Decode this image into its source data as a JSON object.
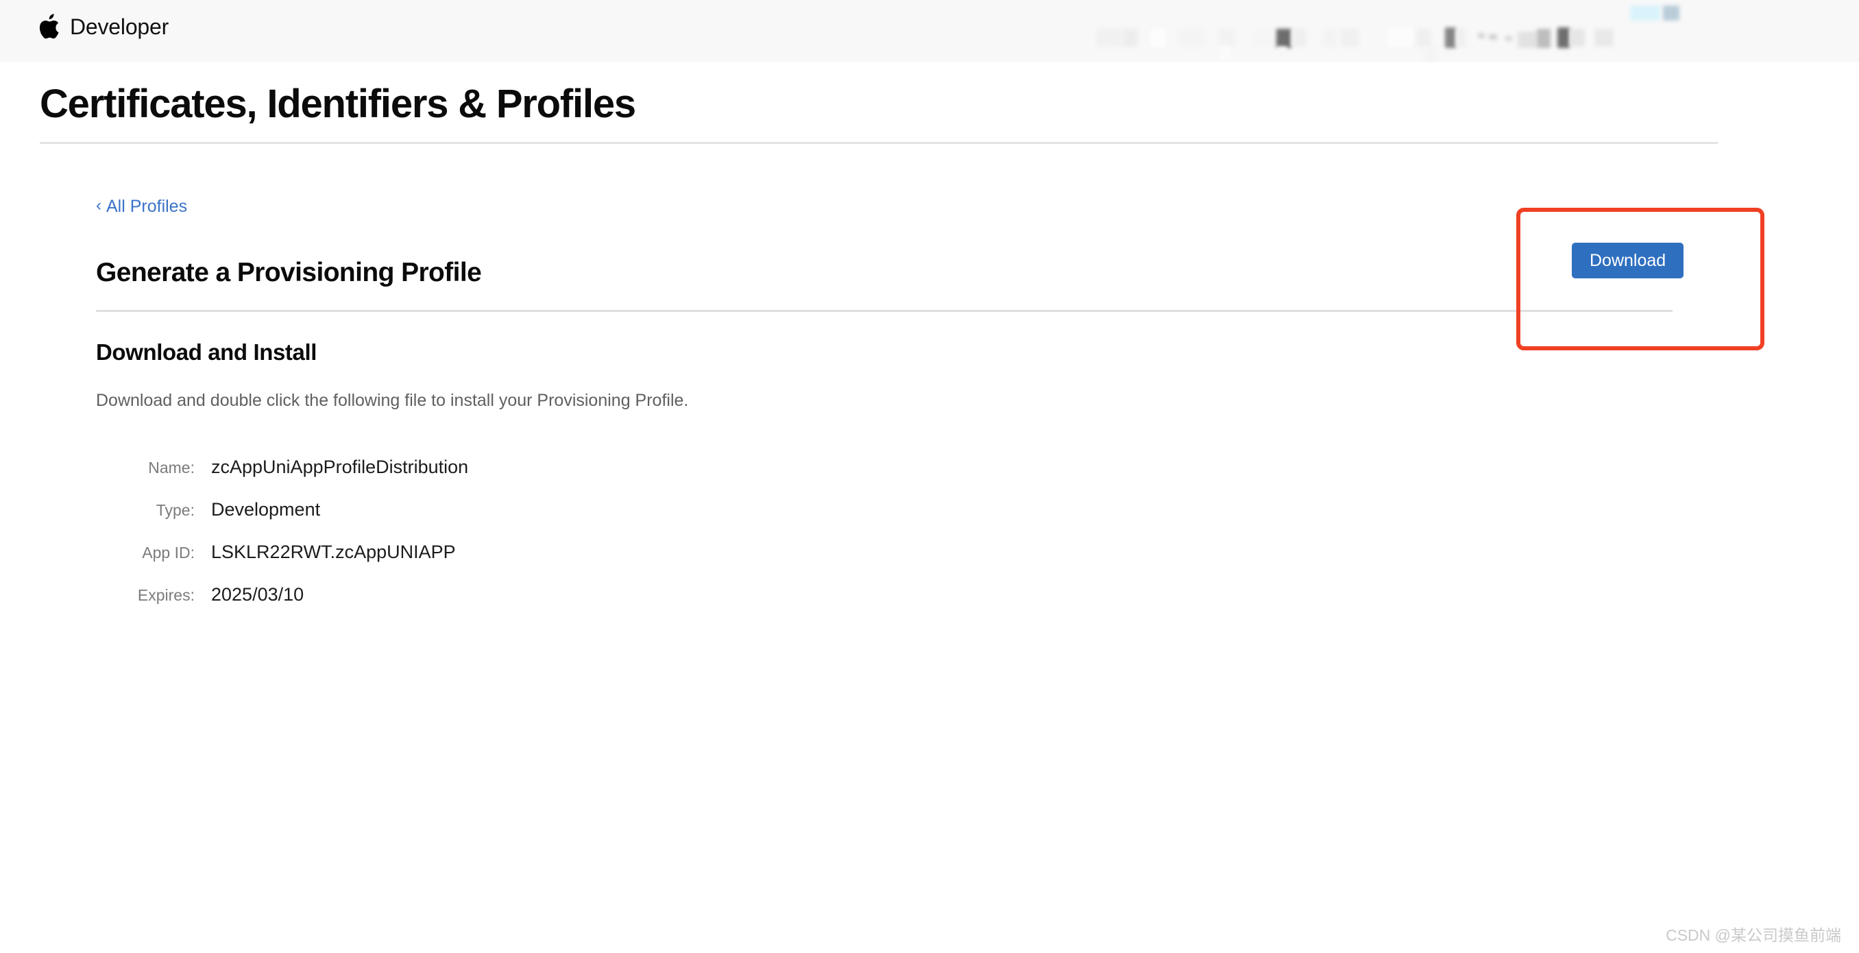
{
  "header": {
    "logo_icon": "apple-logo-icon",
    "brand_name": "Developer",
    "nav_redacted": true
  },
  "page": {
    "title": "Certificates, Identifiers & Profiles"
  },
  "breadcrumb": {
    "chevron": "‹",
    "label": "All Profiles"
  },
  "main": {
    "heading": "Generate a Provisioning Profile",
    "download_label": "Download",
    "subsection": {
      "heading": "Download and Install",
      "description": "Download and double click the following file to install your Provisioning Profile."
    },
    "details": [
      {
        "label": "Name:",
        "value": "zcAppUniAppProfileDistribution"
      },
      {
        "label": "Type:",
        "value": "Development"
      },
      {
        "label": "App ID:",
        "value": "LSKLR22RWT.zcAppUNIAPP"
      },
      {
        "label": "Expires:",
        "value": "2025/03/10"
      }
    ]
  },
  "watermark": {
    "text": "CSDN @某公司摸鱼前端"
  },
  "colors": {
    "accent_blue": "#2f6fc0",
    "link_blue": "#3a72c8",
    "annotation_red": "#f04024",
    "header_bg": "#f8f8f8",
    "rule_gray": "#e3e3e3"
  }
}
